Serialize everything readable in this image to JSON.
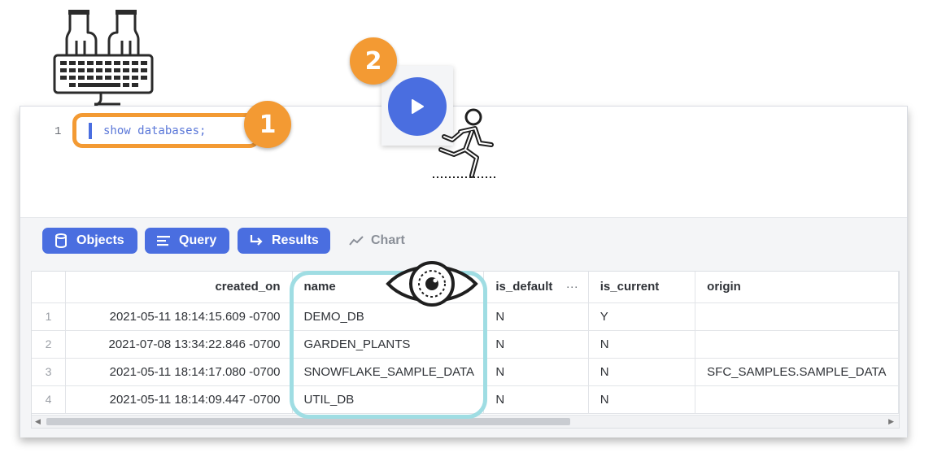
{
  "editor": {
    "line_number": "1",
    "code": "show databases;"
  },
  "annotations": {
    "step1": "1",
    "step2": "2"
  },
  "toolbar": {
    "objects_label": "Objects",
    "query_label": "Query",
    "results_label": "Results",
    "chart_label": "Chart"
  },
  "table": {
    "columns": [
      "created_on",
      "name",
      "is_default",
      "is_current",
      "origin"
    ],
    "rows": [
      {
        "idx": "1",
        "created_on": "2021-05-11 18:14:15.609 -0700",
        "name": "DEMO_DB",
        "is_default": "N",
        "is_current": "Y",
        "origin": ""
      },
      {
        "idx": "2",
        "created_on": "2021-07-08 13:34:22.846 -0700",
        "name": "GARDEN_PLANTS",
        "is_default": "N",
        "is_current": "N",
        "origin": ""
      },
      {
        "idx": "3",
        "created_on": "2021-05-11 18:14:17.080 -0700",
        "name": "SNOWFLAKE_SAMPLE_DATA",
        "is_default": "N",
        "is_current": "N",
        "origin": "SFC_SAMPLES.SAMPLE_DATA"
      },
      {
        "idx": "4",
        "created_on": "2021-05-11 18:14:09.447 -0700",
        "name": "UTIL_DB",
        "is_default": "N",
        "is_current": "N",
        "origin": ""
      }
    ],
    "column_menu": "···"
  },
  "colors": {
    "accent": "#4a6ee0",
    "annotation_orange": "#f39a33",
    "annotation_teal": "#9fdde3"
  },
  "icons": [
    "keyboard-hands-icon",
    "play-icon",
    "runner-icon",
    "eye-icon",
    "database-icon",
    "query-lines-icon",
    "results-arrow-icon",
    "chart-line-icon"
  ]
}
